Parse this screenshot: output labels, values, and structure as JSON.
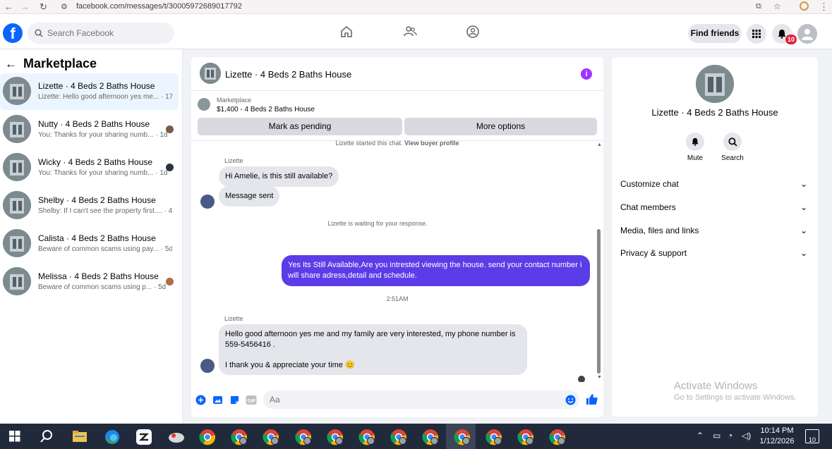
{
  "browser": {
    "url": "facebook.com/messages/t/30005972689017792"
  },
  "header": {
    "search_placeholder": "Search Facebook",
    "find_friends": "Find friends",
    "notification_count": "10"
  },
  "sidebar": {
    "title": "Marketplace",
    "conversations": [
      {
        "name": "Lizette · 4 Beds 2 Baths House",
        "preview": "Lizette: Hello good afternoon yes me...",
        "time": "17h"
      },
      {
        "name": "Nutty · 4 Beds 2 Baths House",
        "preview": "You: Thanks for your sharing numb...",
        "time": "1d"
      },
      {
        "name": "Wicky · 4 Beds 2 Baths House",
        "preview": "You: Thanks for your sharing numb...",
        "time": "1d"
      },
      {
        "name": "Shelby · 4 Beds 2 Baths House",
        "preview": "Shelby: If I can't see the property first....",
        "time": "4d"
      },
      {
        "name": "Calista · 4 Beds 2 Baths House",
        "preview": "Beware of common scams using pay...",
        "time": "5d"
      },
      {
        "name": "Melissa · 4 Beds 2 Baths House",
        "preview": "Beware of common scams using p...",
        "time": "5d"
      }
    ]
  },
  "chat": {
    "title": "Lizette · 4 Beds 2 Baths House",
    "marketplace_label": "Marketplace",
    "listing": "$1,400 - 4 Beds 2 Baths House",
    "mark_pending": "Mark as pending",
    "more_options": "More options",
    "started_notice": "Lizette started this chat.",
    "view_buyer_profile": "View buyer profile",
    "sender1": "Lizette",
    "msg1": "Hi Amelie, is this still available?",
    "msg2": "Message sent",
    "waiting": "Lizette is waiting for your response.",
    "outgoing": "Yes Its Still Available,Are you intrested viewing the house. send your contact number i will share adress,detail and schedule.",
    "time": "2:51AM",
    "sender2": "Lizette",
    "msg3a": "Hello good afternoon yes me and my family are very interested, my phone number is 559-5456416  .",
    "msg3b": "I thank you & appreciate your time 😊",
    "input_placeholder": "Aa"
  },
  "details": {
    "title": "Lizette · 4 Beds 2 Baths House",
    "mute": "Mute",
    "search": "Search",
    "sections": [
      "Customize chat",
      "Chat members",
      "Media, files and links",
      "Privacy & support"
    ],
    "activate_title": "Activate Windows",
    "activate_sub": "Go to Settings to activate Windows."
  },
  "taskbar": {
    "time": "10:14 PM",
    "date": "1/12/2026",
    "notif": "10"
  },
  "colors": {
    "brand": "#0866ff",
    "outgoing_bubble": "#5b3de8",
    "info": "#a033ff"
  }
}
